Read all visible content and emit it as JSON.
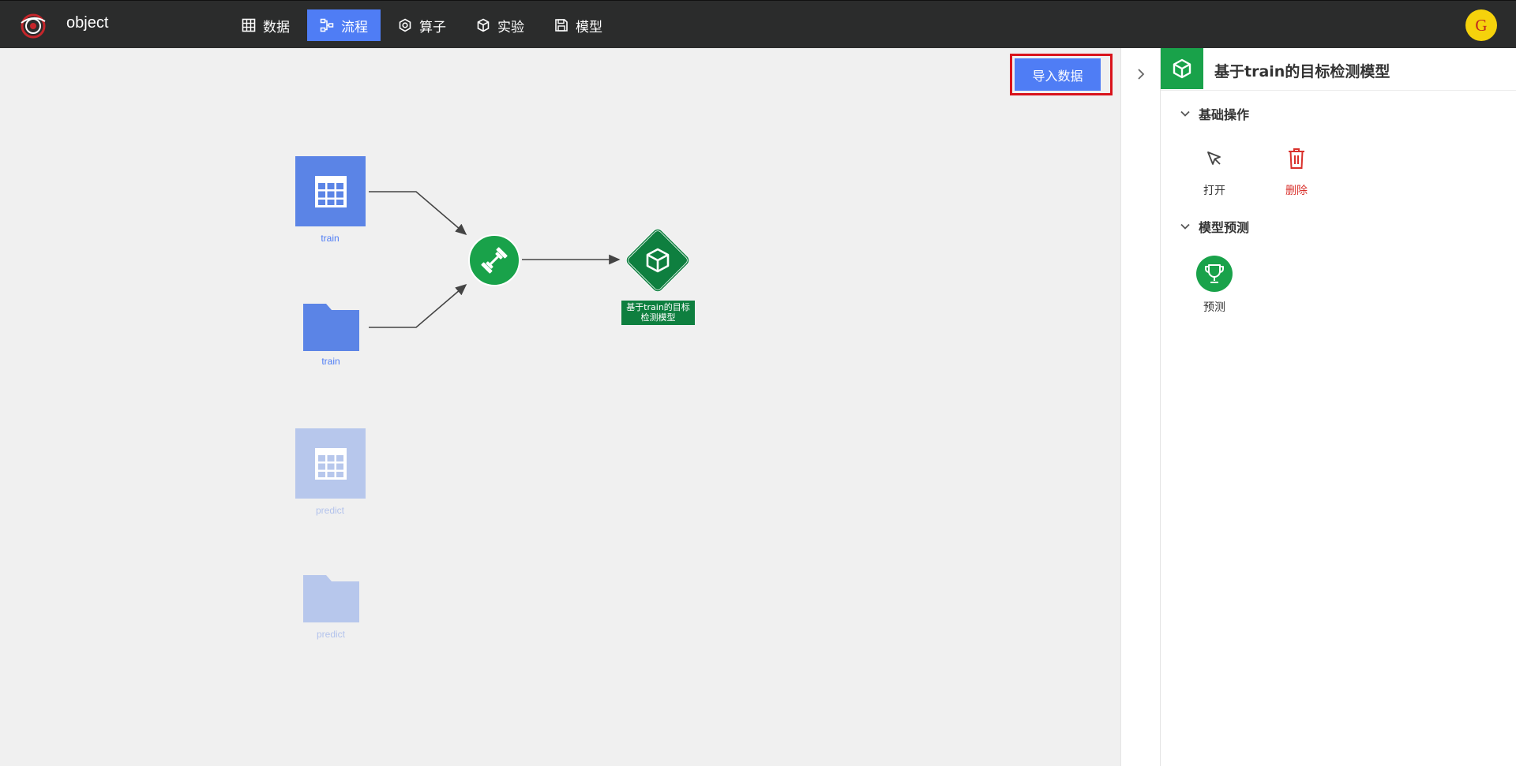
{
  "app": {
    "title": "object",
    "avatar_initial": "G"
  },
  "nav": [
    {
      "label": "数据",
      "icon": "grid-icon",
      "active": false
    },
    {
      "label": "流程",
      "icon": "flow-icon",
      "active": true
    },
    {
      "label": "算子",
      "icon": "hexagon-icon",
      "active": false
    },
    {
      "label": "实验",
      "icon": "cube-icon",
      "active": false
    },
    {
      "label": "模型",
      "icon": "save-icon",
      "active": false
    }
  ],
  "canvas": {
    "import_button": "导入数据",
    "nodes": {
      "train_table": "train",
      "train_folder": "train",
      "predict_table": "predict",
      "predict_folder": "predict",
      "model_line1": "基于train的目标",
      "model_line2": "检测模型"
    }
  },
  "panel": {
    "title": "基于train的目标检测模型",
    "sections": [
      {
        "title": "基础操作",
        "actions": [
          {
            "label": "打开",
            "icon": "cursor-icon"
          },
          {
            "label": "删除",
            "icon": "trash-icon"
          }
        ]
      },
      {
        "title": "模型预测",
        "actions": [
          {
            "label": "预测",
            "icon": "trophy-icon"
          }
        ]
      }
    ]
  },
  "colors": {
    "accent": "#4f7df5",
    "green": "#19a24a",
    "danger": "#d9312c",
    "topbar": "#2b2c2c"
  }
}
